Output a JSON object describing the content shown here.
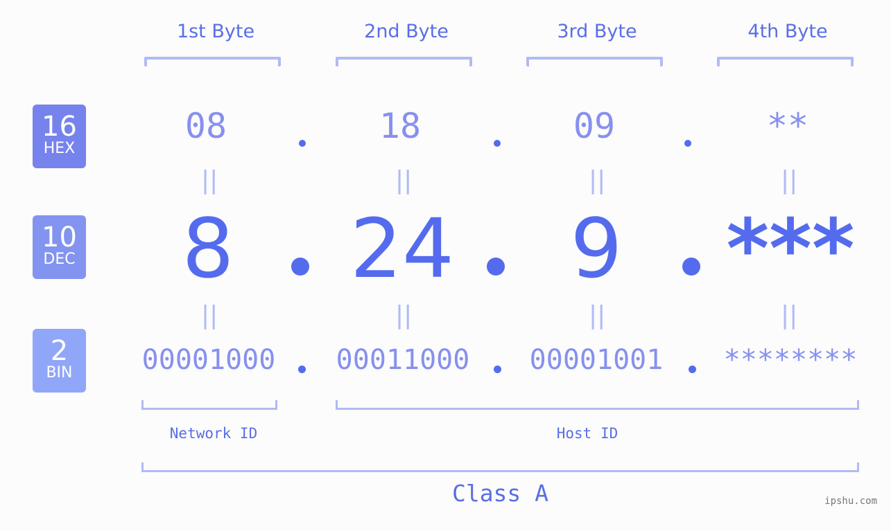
{
  "bytes": [
    {
      "header": "1st Byte",
      "hex": "08",
      "dec": "8",
      "bin": "00001000"
    },
    {
      "header": "2nd Byte",
      "hex": "18",
      "dec": "24",
      "bin": "00011000"
    },
    {
      "header": "3rd Byte",
      "hex": "09",
      "dec": "9",
      "bin": "00001001"
    },
    {
      "header": "4th Byte",
      "hex": "**",
      "dec": "***",
      "bin": "********"
    }
  ],
  "bases": {
    "hex": {
      "radix": "16",
      "label": "HEX",
      "color": "#7683ec"
    },
    "dec": {
      "radix": "10",
      "label": "DEC",
      "color": "#8393f0"
    },
    "bin": {
      "radix": "2",
      "label": "BIN",
      "color": "#90a6f8"
    }
  },
  "equals_sign": "=",
  "separator": ".",
  "sections": {
    "network_id": "Network ID",
    "host_id": "Host ID",
    "class": "Class A"
  },
  "watermark": "ipshu.com",
  "colors": {
    "accent": "#556bee",
    "light": "#8790ee",
    "bracket": "#b1baf5"
  }
}
